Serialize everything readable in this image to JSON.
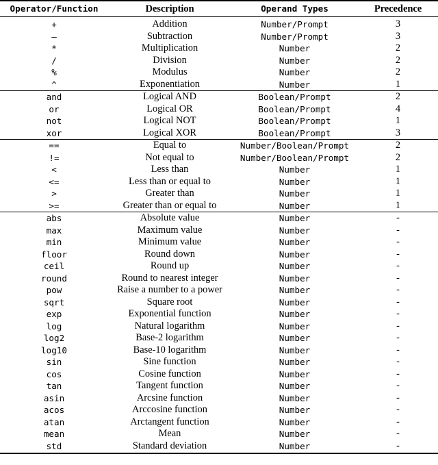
{
  "table": {
    "columns": [
      {
        "key": "operator",
        "label": "Operator/Function",
        "align": "center",
        "font": "mono"
      },
      {
        "key": "description",
        "label": "Description",
        "align": "center",
        "font": "serif"
      },
      {
        "key": "operand_types",
        "label": "Operand Types",
        "align": "center",
        "font": "mono"
      },
      {
        "key": "precedence",
        "label": "Precedence",
        "align": "center",
        "font": "serif"
      }
    ],
    "groups": [
      {
        "name": "arithmetic-operators",
        "rows": [
          {
            "operator": "+",
            "description": "Addition",
            "operand_types": "Number/Prompt",
            "precedence": "3"
          },
          {
            "operator": "–",
            "description": "Subtraction",
            "operand_types": "Number/Prompt",
            "precedence": "3"
          },
          {
            "operator": "*",
            "description": "Multiplication",
            "operand_types": "Number",
            "precedence": "2"
          },
          {
            "operator": "/",
            "description": "Division",
            "operand_types": "Number",
            "precedence": "2"
          },
          {
            "operator": "%",
            "description": "Modulus",
            "operand_types": "Number",
            "precedence": "2"
          },
          {
            "operator": "^",
            "description": "Exponentiation",
            "operand_types": "Number",
            "precedence": "1"
          }
        ]
      },
      {
        "name": "logical-operators",
        "rows": [
          {
            "operator": "and",
            "description": "Logical AND",
            "operand_types": "Boolean/Prompt",
            "precedence": "2"
          },
          {
            "operator": "or",
            "description": "Logical OR",
            "operand_types": "Boolean/Prompt",
            "precedence": "4"
          },
          {
            "operator": "not",
            "description": "Logical NOT",
            "operand_types": "Boolean/Prompt",
            "precedence": "1"
          },
          {
            "operator": "xor",
            "description": "Logical XOR",
            "operand_types": "Boolean/Prompt",
            "precedence": "3"
          }
        ]
      },
      {
        "name": "comparison-operators",
        "rows": [
          {
            "operator": "==",
            "description": "Equal to",
            "operand_types": "Number/Boolean/Prompt",
            "precedence": "2"
          },
          {
            "operator": "!=",
            "description": "Not equal to",
            "operand_types": "Number/Boolean/Prompt",
            "precedence": "2"
          },
          {
            "operator": "<",
            "description": "Less than",
            "operand_types": "Number",
            "precedence": "1"
          },
          {
            "operator": "<=",
            "description": "Less than or equal to",
            "operand_types": "Number",
            "precedence": "1"
          },
          {
            "operator": ">",
            "description": "Greater than",
            "operand_types": "Number",
            "precedence": "1"
          },
          {
            "operator": ">=",
            "description": "Greater than or equal to",
            "operand_types": "Number",
            "precedence": "1"
          }
        ]
      },
      {
        "name": "math-functions",
        "rows": [
          {
            "operator": "abs",
            "description": "Absolute value",
            "operand_types": "Number",
            "precedence": "-"
          },
          {
            "operator": "max",
            "description": "Maximum value",
            "operand_types": "Number",
            "precedence": "-"
          },
          {
            "operator": "min",
            "description": "Minimum value",
            "operand_types": "Number",
            "precedence": "-"
          },
          {
            "operator": "floor",
            "description": "Round down",
            "operand_types": "Number",
            "precedence": "-"
          },
          {
            "operator": "ceil",
            "description": "Round up",
            "operand_types": "Number",
            "precedence": "-"
          },
          {
            "operator": "round",
            "description": "Round to nearest integer",
            "operand_types": "Number",
            "precedence": "-"
          },
          {
            "operator": "pow",
            "description": "Raise a number to a power",
            "operand_types": "Number",
            "precedence": "-"
          },
          {
            "operator": "sqrt",
            "description": "Square root",
            "operand_types": "Number",
            "precedence": "-"
          },
          {
            "operator": "exp",
            "description": "Exponential function",
            "operand_types": "Number",
            "precedence": "-"
          },
          {
            "operator": "log",
            "description": "Natural logarithm",
            "operand_types": "Number",
            "precedence": "-"
          },
          {
            "operator": "log2",
            "description": "Base-2 logarithm",
            "operand_types": "Number",
            "precedence": "-"
          },
          {
            "operator": "log10",
            "description": "Base-10 logarithm",
            "operand_types": "Number",
            "precedence": "-"
          },
          {
            "operator": "sin",
            "description": "Sine function",
            "operand_types": "Number",
            "precedence": "-"
          },
          {
            "operator": "cos",
            "description": "Cosine function",
            "operand_types": "Number",
            "precedence": "-"
          },
          {
            "operator": "tan",
            "description": "Tangent function",
            "operand_types": "Number",
            "precedence": "-"
          },
          {
            "operator": "asin",
            "description": "Arcsine function",
            "operand_types": "Number",
            "precedence": "-"
          },
          {
            "operator": "acos",
            "description": "Arccosine function",
            "operand_types": "Number",
            "precedence": "-"
          },
          {
            "operator": "atan",
            "description": "Arctangent function",
            "operand_types": "Number",
            "precedence": "-"
          },
          {
            "operator": "mean",
            "description": "Mean",
            "operand_types": "Number",
            "precedence": "-"
          },
          {
            "operator": "std",
            "description": "Standard deviation",
            "operand_types": "Number",
            "precedence": "-"
          }
        ]
      }
    ]
  },
  "style": {
    "text_color": "#000000",
    "rule_color": "#000000",
    "background": "#ffffff"
  }
}
